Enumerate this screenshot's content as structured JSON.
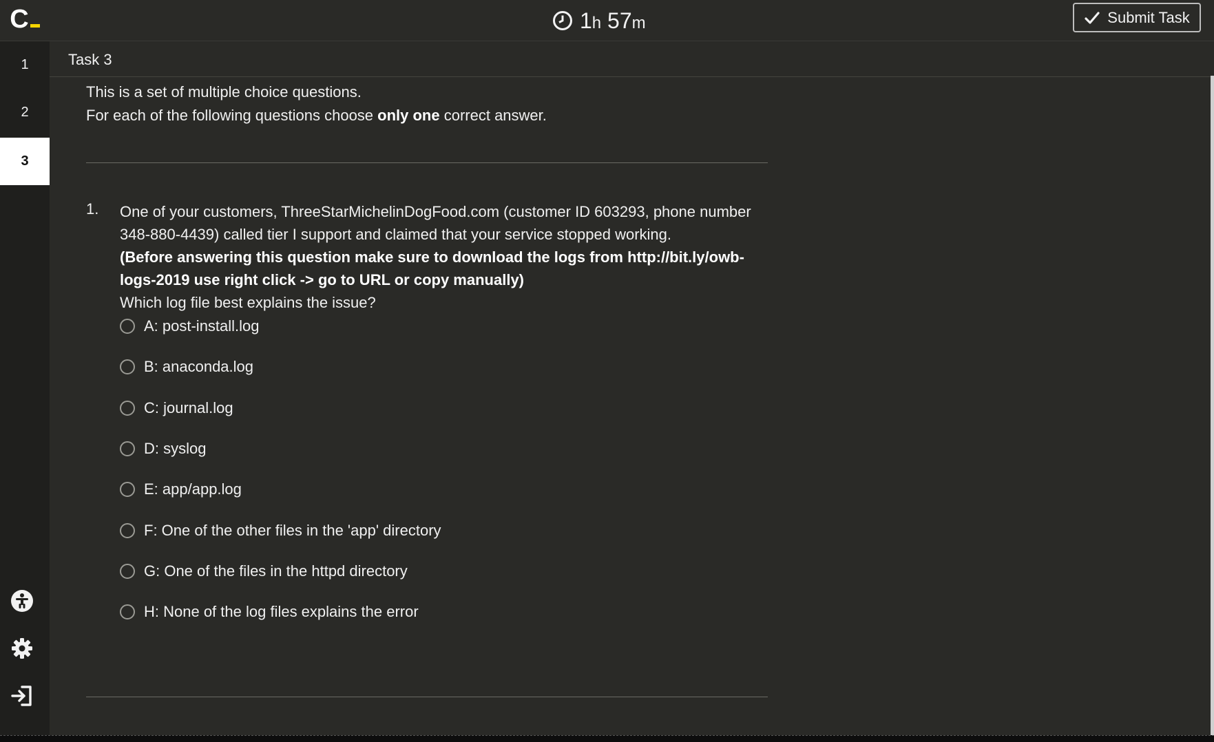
{
  "app": {
    "logo_letter": "C"
  },
  "header": {
    "timer": {
      "hours": "1",
      "hours_unit": "h",
      "minutes": "57",
      "minutes_unit": "m"
    },
    "submit_label": "Submit Task"
  },
  "sidebar": {
    "tasks": [
      {
        "label": "1",
        "active": false
      },
      {
        "label": "2",
        "active": false
      },
      {
        "label": "3",
        "active": true
      }
    ],
    "icons": [
      "accessibility-icon",
      "settings-icon",
      "exit-icon"
    ]
  },
  "task": {
    "title": "Task 3",
    "intro_line1": "This is a set of multiple choice questions.",
    "intro_line2_pre": "For each of the following questions choose ",
    "intro_line2_bold": "only one",
    "intro_line2_post": " correct answer.",
    "question": {
      "number": "1.",
      "text_part1": "One of your customers, ThreeStarMichelinDogFood.com (customer ID 603293, phone number 348-880-4439) called tier I support and claimed that your service stopped working.",
      "text_bold": "(Before answering this question make sure to download the logs from http://bit.ly/owb-logs-2019 use right click -> go to URL or copy manually)",
      "text_part2": "Which log file best explains the issue?",
      "options": [
        "A: post-install.log",
        "B: anaconda.log",
        "C: journal.log",
        "D: syslog",
        "E: app/app.log",
        "F: One of the other files in the 'app' directory",
        "G: One of the files in the httpd directory",
        "H: None of the log files explains the error"
      ]
    }
  }
}
